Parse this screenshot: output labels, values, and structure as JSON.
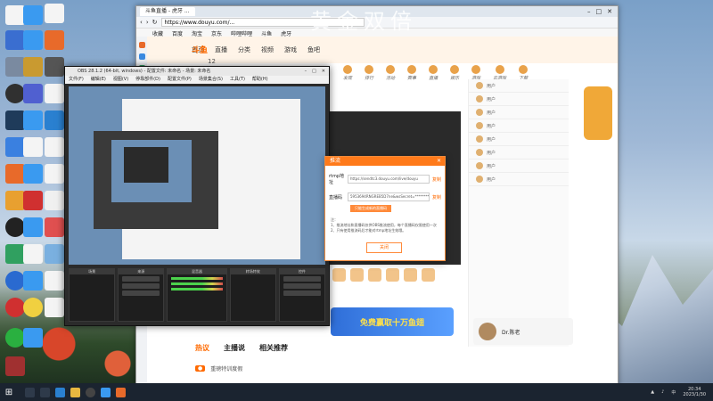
{
  "watermark": "黄金双倍",
  "browser": {
    "tab_title": "斗鱼直播 - 虎牙 ...",
    "address": "https://www.douyu.com/...",
    "favorites": [
      "收藏",
      "百度",
      "淘宝",
      "京东",
      "哔哩哔哩",
      "斗鱼",
      "虎牙"
    ]
  },
  "site": {
    "logo": "斗鱼",
    "nav": [
      "首页",
      "直播",
      "分类",
      "视频",
      "游戏",
      "鱼吧"
    ],
    "sub_icons": [
      "发现",
      "排行",
      "活动",
      "赛事",
      "直播",
      "娱乐",
      "游戏",
      "云游戏",
      "下载"
    ],
    "badge_count": "12",
    "promo_banner": "免费赢取十万鱼翅",
    "lower_tabs": [
      "主播说",
      "相关推荐"
    ],
    "hot_label": "热议",
    "lower_row": "重磅特训度假",
    "anchor_name": "Dr.陈老",
    "chat_rows": [
      "用户",
      "用户",
      "用户",
      "用户",
      "用户",
      "用户",
      "用户",
      "用户"
    ]
  },
  "obs": {
    "title": "OBS 28.1.2 (64-bit, windows) - 配置文件: 未命名 - 场景: 未命名",
    "menu": [
      "文件(F)",
      "编辑(E)",
      "视图(V)",
      "停靠部件(D)",
      "配置文件(P)",
      "场景集合(S)",
      "工具(T)",
      "帮助(H)"
    ],
    "docks": [
      "场景",
      "来源",
      "混音器",
      "转场特效",
      "控件"
    ]
  },
  "dialog": {
    "title": "推流",
    "rtmp_label": "rtmp地址",
    "rtmp_value": "https://sendtc3.douyu.com/live/douyu",
    "rtmp_copy": "复制",
    "key_label": "直播码",
    "key_value": "5953694RNGREB5D7ne&wsSecret=**********",
    "key_copy": "复制",
    "regen": "只能生成新的直播码",
    "notes_title": "注：",
    "notes": [
      "1、推流地址和直播码仅供OBS推流使用，每个直播码仅限使用一次",
      "2、只有使用推流码后才能对rtmp地址生效哦。"
    ],
    "close": "关闭"
  },
  "taskbar": {
    "time": "20:34",
    "date": "2023/1/30"
  }
}
